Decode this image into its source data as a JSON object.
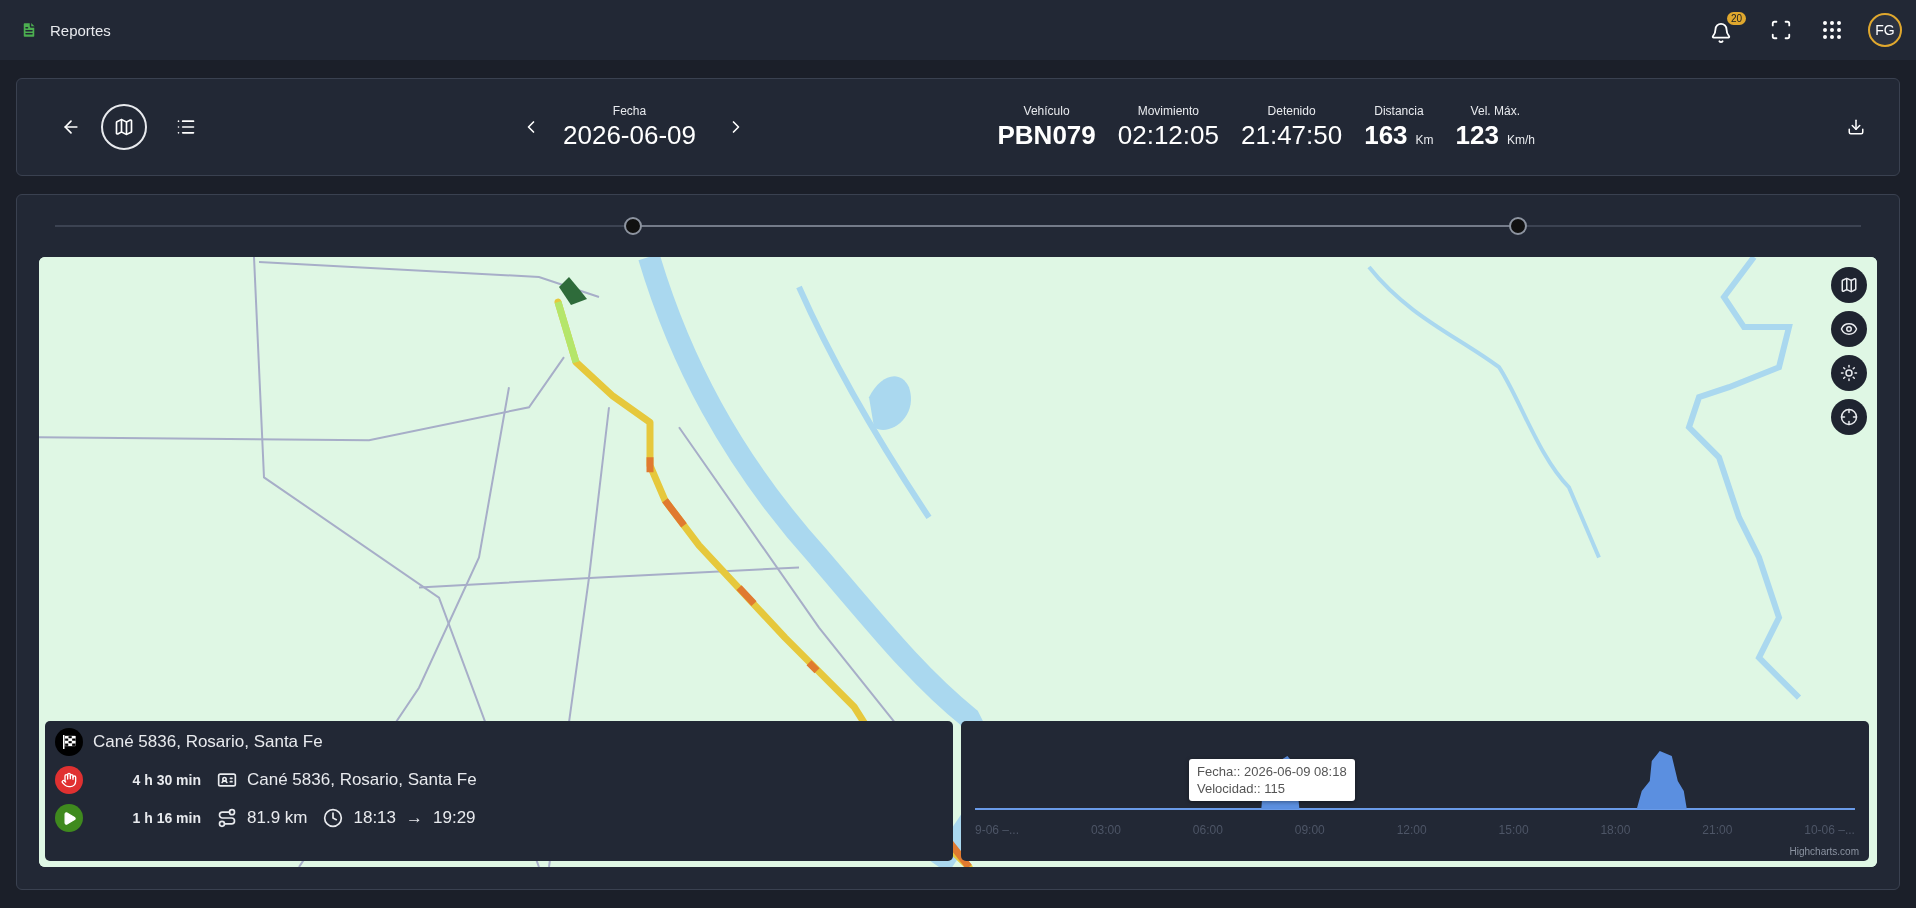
{
  "app": {
    "title": "Reportes",
    "notifications": "20",
    "avatar": "FG"
  },
  "header": {
    "views": [
      {
        "kind": "map",
        "selected": true
      },
      {
        "kind": "list",
        "selected": false
      }
    ],
    "date_label": "Fecha",
    "date": "2026-06-09",
    "stats": [
      {
        "kind": "plate",
        "label": "Vehículo",
        "value": "PBN079"
      },
      {
        "kind": "time",
        "label": "Movimiento",
        "value": "02:12:05"
      },
      {
        "kind": "time",
        "label": "Detenido",
        "value": "21:47:50"
      },
      {
        "kind": "measure",
        "label": "Distancia",
        "value": "163",
        "unit": "Km"
      },
      {
        "kind": "measure",
        "label": "Vel. Máx.",
        "value": "123",
        "unit": "Km/h"
      }
    ]
  },
  "range": {
    "start": {
      "level": 0.32
    },
    "end": {
      "level": 0.81
    }
  },
  "map_controls": [
    {
      "kind": "map"
    },
    {
      "kind": "eye"
    },
    {
      "kind": "brightness"
    },
    {
      "kind": "target"
    }
  ],
  "timeline": [
    {
      "kind": "finish",
      "address": "Cané 5836, Rosario, Santa Fe"
    },
    {
      "kind": "stop",
      "duration": "4 h 30 min",
      "address": "Cané 5836, Rosario, Santa Fe"
    },
    {
      "kind": "drive",
      "duration": "1 h 16 min",
      "distance": "81.9 km",
      "start": "18:13",
      "arrow": "→",
      "end": "19:29"
    }
  ],
  "speed_chart": {
    "xticks": [
      "9-06 –...",
      "03:00",
      "06:00",
      "09:00",
      "12:00",
      "15:00",
      "18:00",
      "21:00",
      "10-06 –..."
    ],
    "tooltip": [
      "Fecha:: 2026-06-09 08:18",
      "Velocidad:: 115"
    ],
    "credit": "Highcharts.com"
  }
}
